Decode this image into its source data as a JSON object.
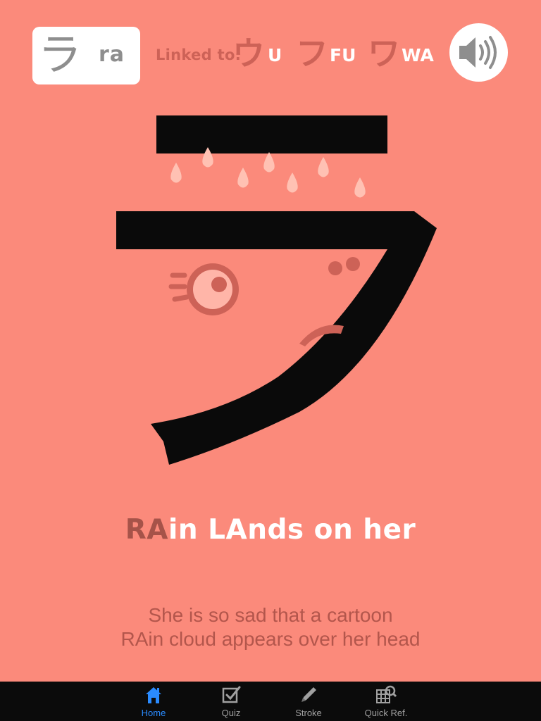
{
  "card": {
    "kana": "ラ",
    "romaji": "ra"
  },
  "linked": {
    "label": "Linked to:",
    "items": [
      {
        "kana": "ウ",
        "romaji": "U"
      },
      {
        "kana": "フ",
        "romaji": "FU"
      },
      {
        "kana": "ワ",
        "romaji": "WA"
      }
    ]
  },
  "sound": {
    "icon": "speaker-icon"
  },
  "mnemonic": {
    "highlight": "RA",
    "rest": "in LAnds on her"
  },
  "description": {
    "line1": "She is so sad that a cartoon",
    "line2": "RAin cloud appears over her head"
  },
  "tabs": [
    {
      "label": "Home",
      "icon": "home-icon",
      "active": true
    },
    {
      "label": "Quiz",
      "icon": "checkbox-icon",
      "active": false
    },
    {
      "label": "Stroke",
      "icon": "pencil-icon",
      "active": false
    },
    {
      "label": "Quick Ref.",
      "icon": "grid-search-icon",
      "active": false
    }
  ],
  "colors": {
    "background": "#FB8A7B",
    "accent": "#CD6257",
    "stroke": "#0A0A0A",
    "tab_active": "#2A8BFF"
  }
}
